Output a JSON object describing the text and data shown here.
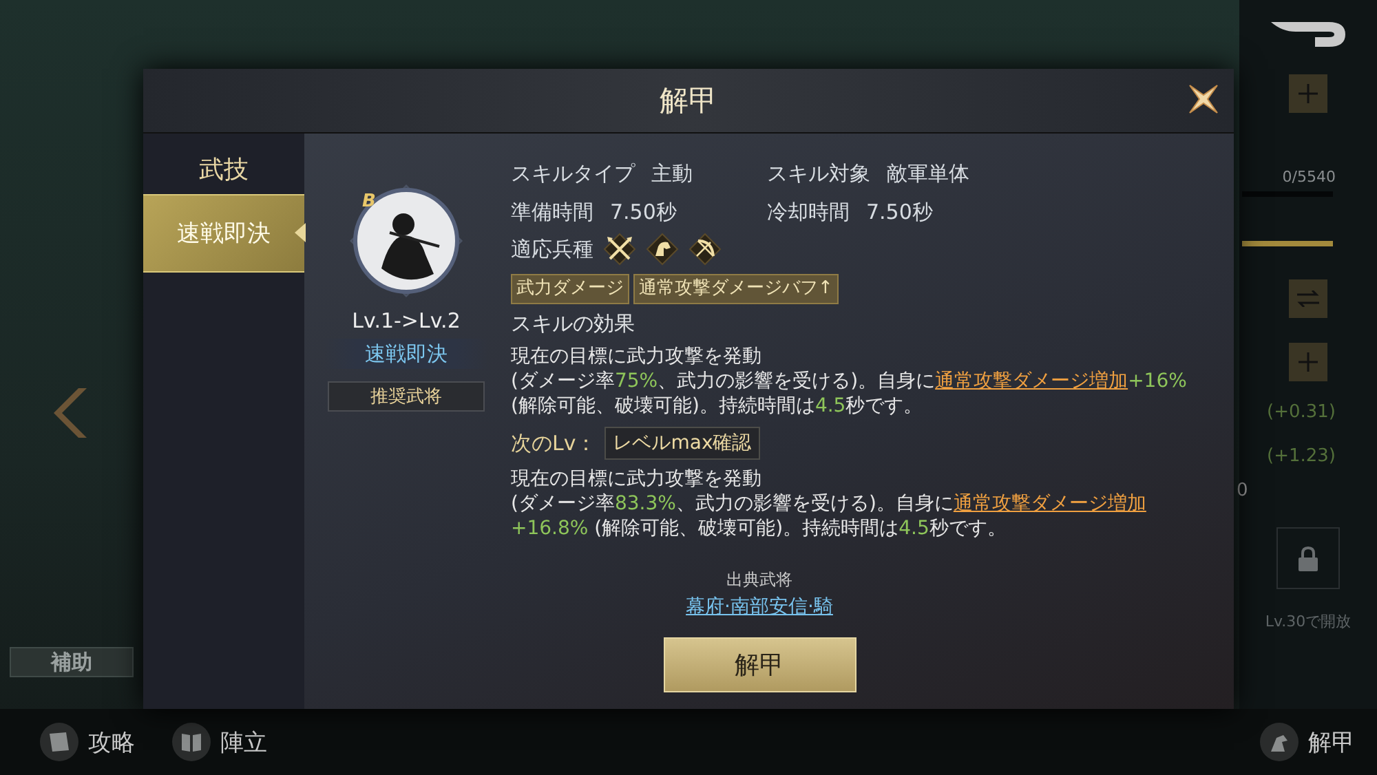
{
  "background": {
    "exp_bar": {
      "reading": "0/5540",
      "level": 0
    },
    "stat_gains": [
      "(+0.31)",
      "(+1.23)"
    ],
    "partial_value": "0",
    "locked_slot": {
      "caption": "Lv.30で開放"
    },
    "side_tab": "補助",
    "bottom_bar": [
      {
        "label": "攻略",
        "kind": "guide"
      },
      {
        "label": "陣立",
        "kind": "formation"
      }
    ],
    "bottom_right": {
      "label": "解甲"
    }
  },
  "dialog": {
    "title": "解甲",
    "sidebar": {
      "heading": "武技",
      "items": [
        {
          "label": "速戦即決",
          "selected": true
        }
      ]
    },
    "skill": {
      "rank": "B",
      "level_text": "Lv.1->Lv.2",
      "name": "速戦即決",
      "recommend_button": "推奨武将"
    },
    "stats": [
      {
        "label": "スキルタイプ",
        "value": "主動"
      },
      {
        "label": "スキル対象",
        "value": "敵軍単体"
      },
      {
        "label": "準備時間",
        "value": "7.50秒"
      },
      {
        "label": "冷却時間",
        "value": "7.50秒"
      }
    ],
    "troop_label": "適応兵種",
    "troop_types": [
      {
        "kind": "spear"
      },
      {
        "kind": "cavalry"
      },
      {
        "kind": "bow"
      }
    ],
    "tags": [
      "武力ダメージ",
      "通常攻撃ダメージバフ↑"
    ],
    "effect_heading": "スキルの効果",
    "current_effect": [
      [
        {
          "kind": "text",
          "text": "現在の目標に武力攻撃を発動"
        }
      ],
      [
        {
          "kind": "text",
          "text": "(ダメージ率"
        },
        {
          "kind": "value",
          "text": "75%"
        },
        {
          "kind": "text",
          "text": "、武力の影響を受ける)。自身に"
        },
        {
          "kind": "link",
          "text": "通常攻撃ダメージ増加"
        },
        {
          "kind": "value",
          "text": "+16%"
        },
        {
          "kind": "text",
          "text": " (解除可能、破壊可能)。持続時間は"
        },
        {
          "kind": "value",
          "text": "4.5"
        },
        {
          "kind": "text",
          "text": "秒です。"
        }
      ]
    ],
    "next_label": "次のLv：",
    "next_button": "レベルmax確認",
    "next_effect": [
      [
        {
          "kind": "text",
          "text": "現在の目標に武力攻撃を発動"
        }
      ],
      [
        {
          "kind": "text",
          "text": "(ダメージ率"
        },
        {
          "kind": "value",
          "text": "83.3%"
        },
        {
          "kind": "text",
          "text": "、武力の影響を受ける)。自身に"
        },
        {
          "kind": "link",
          "text": "通常攻撃ダメージ増加"
        },
        {
          "kind": "value",
          "text": "+16.8%"
        },
        {
          "kind": "text",
          "text": " (解除可能、破壊可能)。持続時間は"
        },
        {
          "kind": "value",
          "text": "4.5"
        },
        {
          "kind": "text",
          "text": "秒です。"
        }
      ]
    ],
    "source_label": "出典武将",
    "source_link": "幕府·南部安信·騎",
    "action_button": "解甲"
  }
}
